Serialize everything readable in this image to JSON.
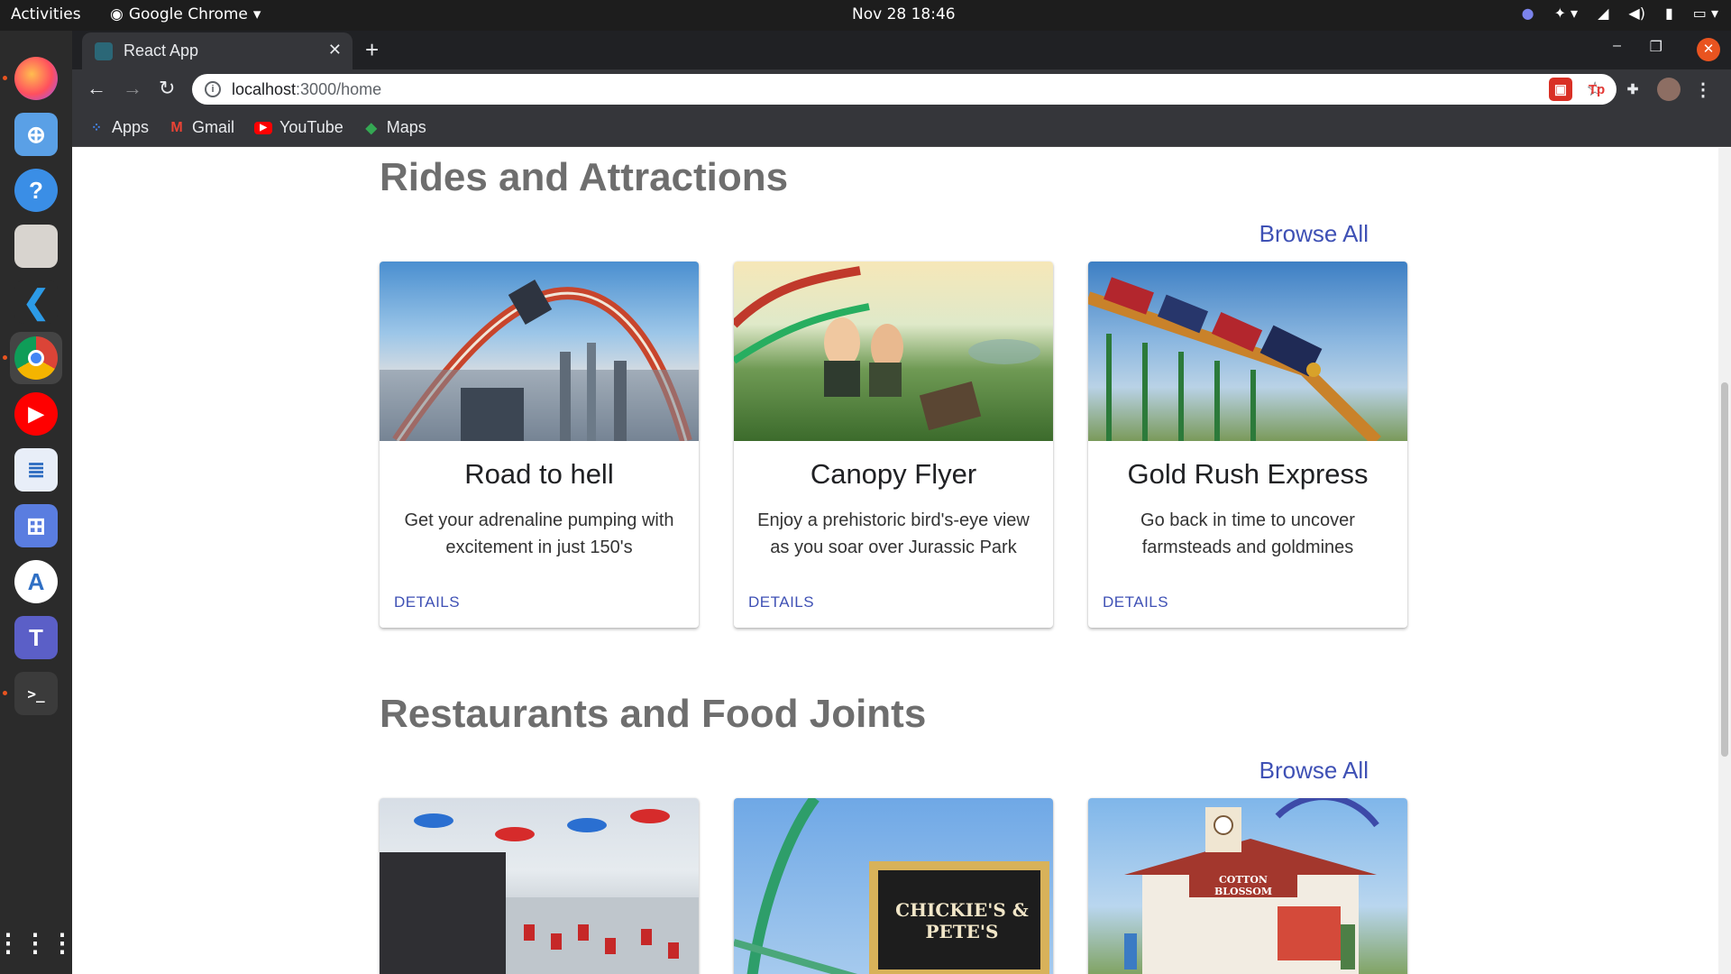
{
  "system_bar": {
    "activities": "Activities",
    "app_menu": "Google Chrome",
    "clock": "Nov 28  18:46"
  },
  "browser": {
    "tab_title": "React App",
    "url_host": "localhost",
    "url_path": ":3000/home",
    "bookmarks": [
      {
        "label": "Apps",
        "icon": "apps-grid-icon"
      },
      {
        "label": "Gmail",
        "icon": "gmail-icon"
      },
      {
        "label": "YouTube",
        "icon": "youtube-icon"
      },
      {
        "label": "Maps",
        "icon": "maps-icon"
      }
    ]
  },
  "dock": [
    "firefox",
    "software",
    "help",
    "files",
    "vscode",
    "chrome",
    "youtube-music",
    "writer",
    "screenshot",
    "android-studio",
    "teams",
    "terminal",
    "app-grid"
  ],
  "sections": [
    {
      "title": "Rides and Attractions",
      "browse_all": "Browse All",
      "cards": [
        {
          "title": "Road to hell",
          "description": "Get your adrenaline pumping with excitement in just 150's",
          "action": "DETAILS"
        },
        {
          "title": "Canopy Flyer",
          "description": "Enjoy a prehistoric bird's-eye view as you soar over Jurassic Park",
          "action": "DETAILS"
        },
        {
          "title": "Gold Rush Express",
          "description": "Go back in time to uncover farmsteads and goldmines",
          "action": "DETAILS"
        }
      ]
    },
    {
      "title": "Restaurants and Food Joints",
      "browse_all": "Browse All",
      "cards": [
        {
          "sign_text": ""
        },
        {
          "sign_text": "CHICKIE'S & PETE'S"
        },
        {
          "sign_text": "COTTON BLOSSOM"
        }
      ]
    }
  ],
  "colors": {
    "link": "#3f51b5",
    "section_title": "#6e6e6e",
    "ubuntu_orange": "#e95420"
  }
}
